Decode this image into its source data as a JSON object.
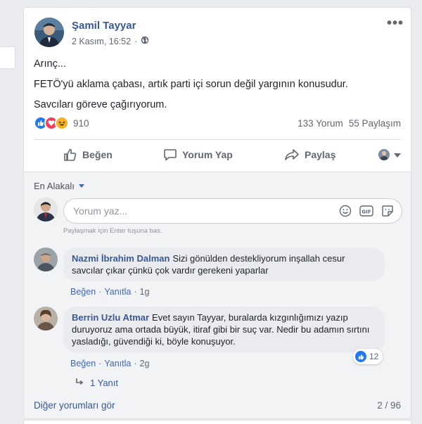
{
  "post": {
    "author": "Şamil Tayyar",
    "date": "2 Kasım, 16:52",
    "lines": [
      "Arınç...",
      "FETÖ'yü aklama çabası, artık parti içi sorun değil yargının konusudur.",
      "Savcıları göreve çağırıyorum."
    ],
    "reaction_count": "910",
    "comment_count": "133 Yorum",
    "share_count": "55 Paylaşım"
  },
  "actions": {
    "like": "Beğen",
    "comment": "Yorum Yap",
    "share": "Paylaş"
  },
  "comments_section": {
    "sort_label": "En Alakalı",
    "compose_placeholder": "Yorum yaz...",
    "hint": "Paylaşmak için Enter tuşuna bas.",
    "comments": [
      {
        "name": "Nazmi İbrahim Dalman",
        "text": "Sizi gönülden destekliyorum inşallah cesur savcılar çıkar çünkü çok vardır gerekeni yaparlar",
        "like": "Beğen",
        "reply": "Yanıtla",
        "time": "1g"
      },
      {
        "name": "Berrin Uzlu Atmar",
        "text": "Evet sayın Tayyar, buralarda kızgınlığımızı yazıp duruyoruz ama ortada büyük, itiraf gibi bir suç var. Nedir bu adamın sırtını yasladığı, güvendiği ki, böyle konuşuyor.",
        "like": "Beğen",
        "reply": "Yanıtla",
        "time": "2g",
        "reactions": "12"
      }
    ],
    "replies_label": "1 Yanıt",
    "more_comments": "Diğer yorumları gör",
    "pager": "2 / 96"
  },
  "colors": {
    "link": "#385898",
    "like_blue": "#2078f4",
    "love_red": "#f33e58",
    "haha_yellow": "#f7b125"
  }
}
